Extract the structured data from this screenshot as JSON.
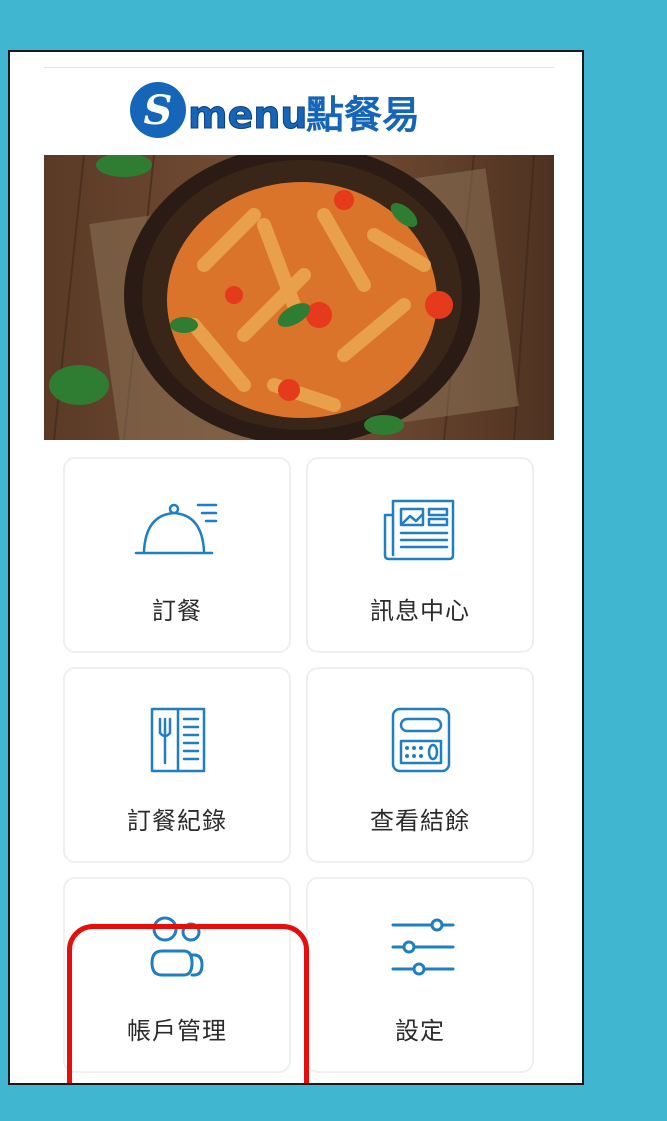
{
  "app": {
    "brand_name": "menu",
    "brand_subtitle": "點餐易",
    "logo_letter": "S"
  },
  "hero": {
    "image": "pasta-dish-photo"
  },
  "menu": {
    "items": [
      {
        "label": "訂餐",
        "icon": "serving-cloche-icon"
      },
      {
        "label": "訊息中心",
        "icon": "newspaper-icon"
      },
      {
        "label": "訂餐紀錄",
        "icon": "menu-book-icon"
      },
      {
        "label": "查看結餘",
        "icon": "calculator-balance-icon"
      },
      {
        "label": "帳戶管理",
        "icon": "users-icon",
        "highlighted": true
      },
      {
        "label": "設定",
        "icon": "sliders-icon"
      }
    ]
  },
  "colors": {
    "background": "#41b6d0",
    "icon_blue": "#1f7fc2",
    "logo_blue": "#1565b8",
    "highlight": "#e60d0d"
  }
}
